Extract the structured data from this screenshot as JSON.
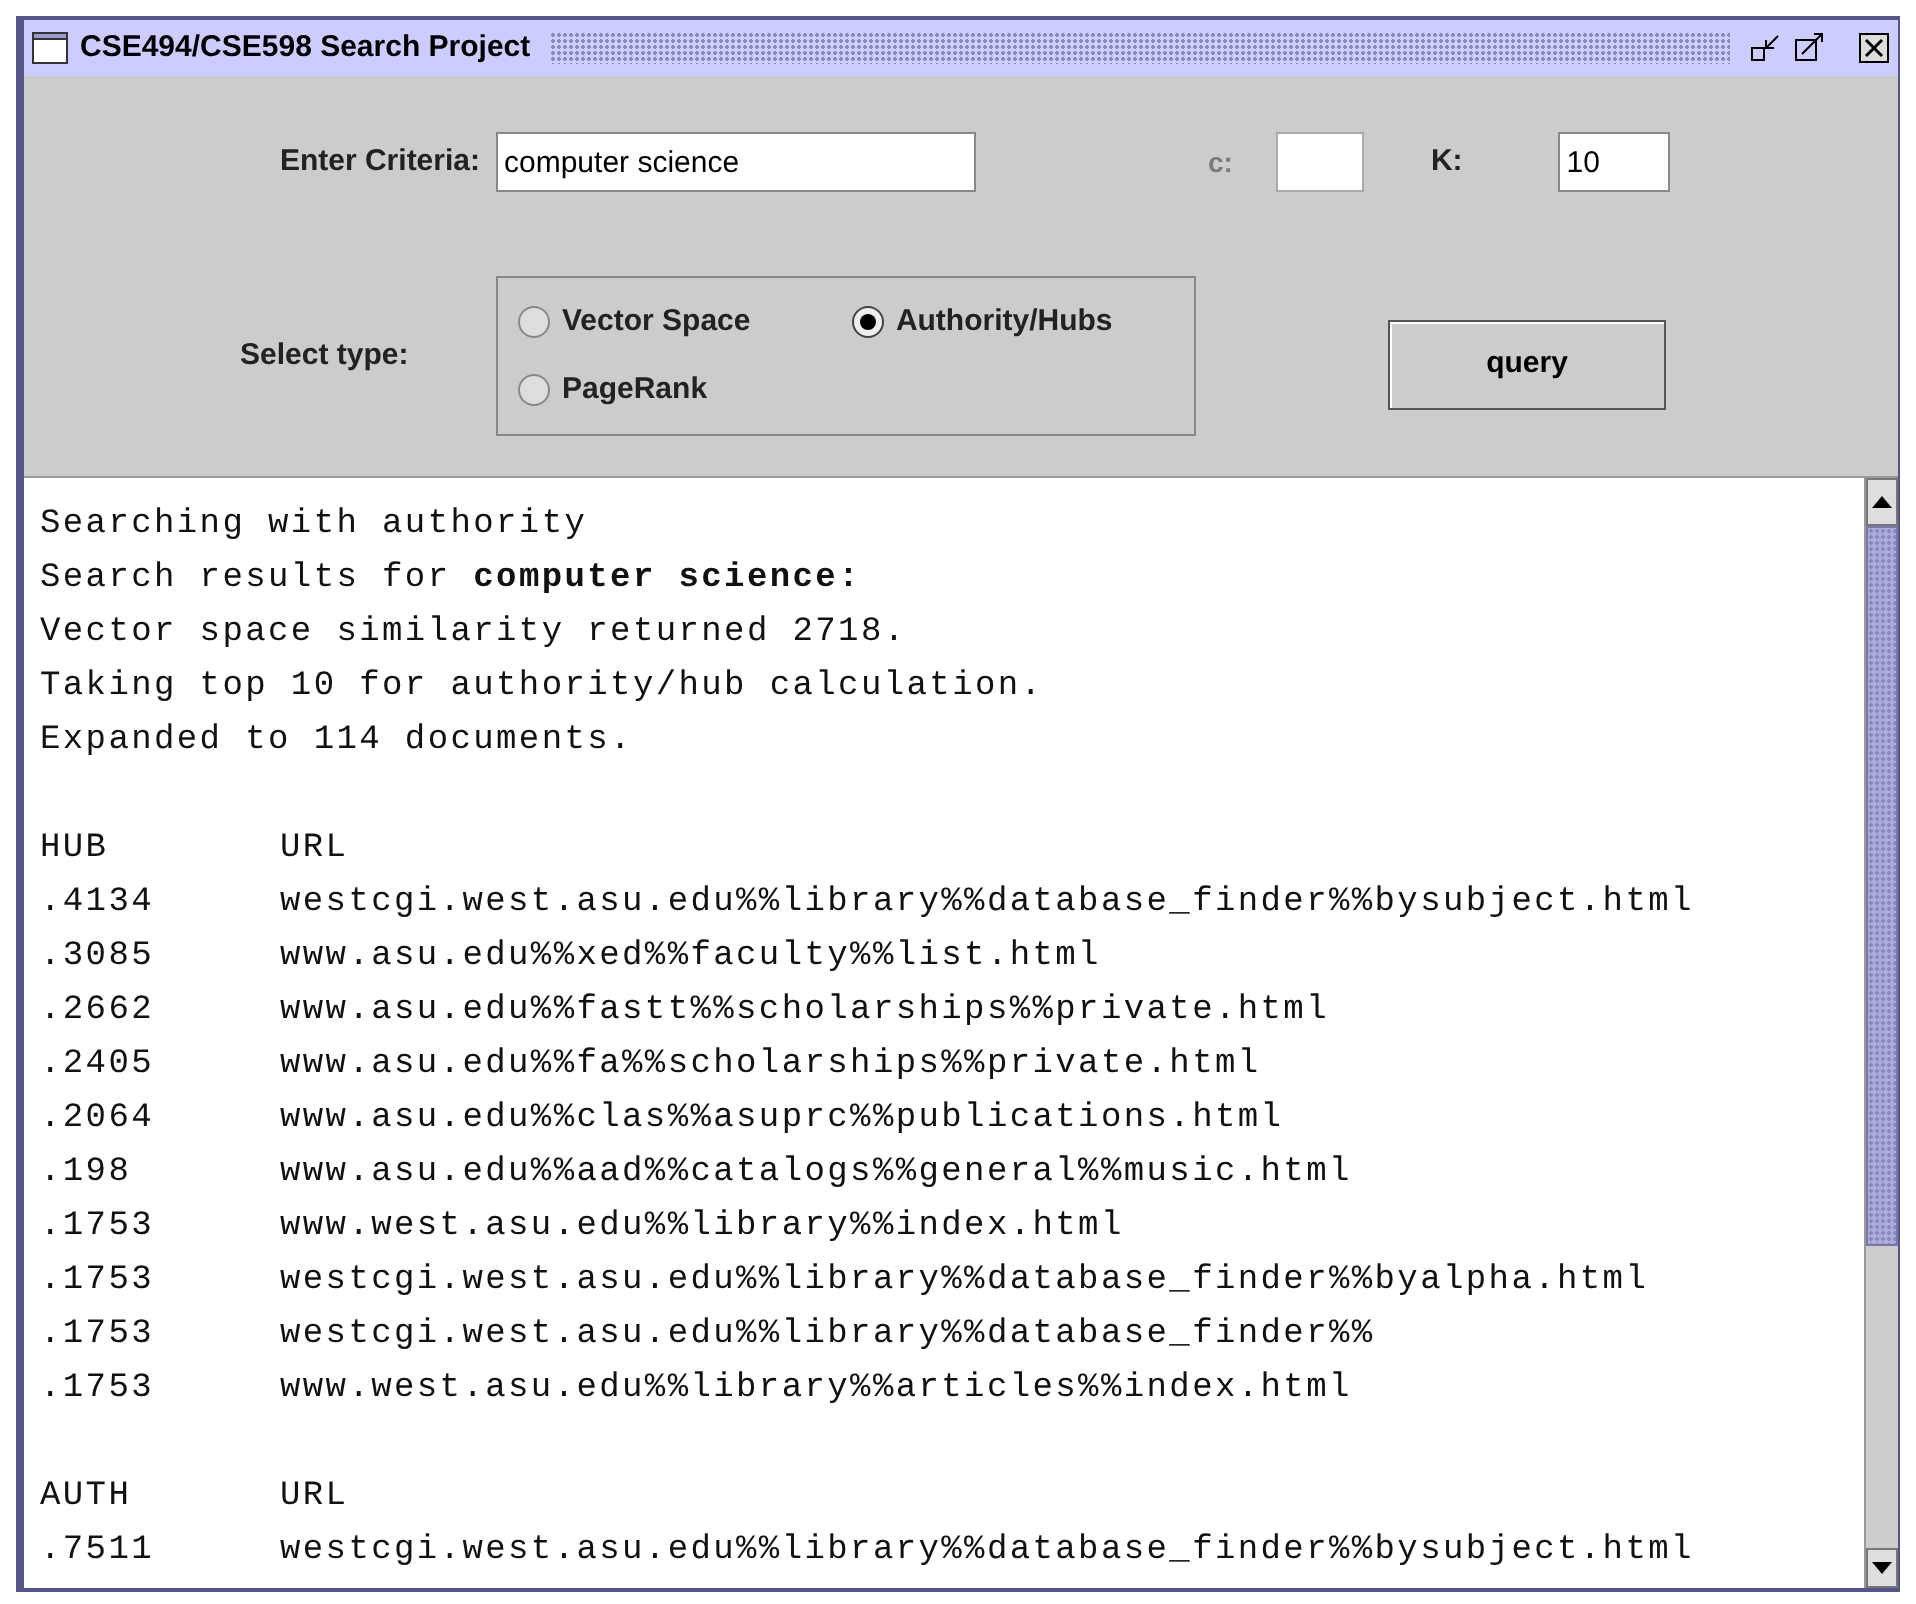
{
  "window": {
    "title": "CSE494/CSE598 Search Project"
  },
  "form": {
    "criteria_label": "Enter Criteria:",
    "criteria_value": "computer science",
    "c_label": "c:",
    "k_label": "K:",
    "k_value": "10",
    "type_label": "Select type:",
    "types": [
      {
        "label": "Vector Space",
        "selected": false
      },
      {
        "label": "Authority/Hubs",
        "selected": true
      },
      {
        "label": "PageRank",
        "selected": false
      }
    ],
    "query_button": "query"
  },
  "output": {
    "lines": [
      {
        "kind": "text",
        "text": "Searching with authority"
      },
      {
        "kind": "text",
        "text": "Search results for **computer science:**"
      },
      {
        "kind": "text",
        "text": "Vector space similarity returned 2718."
      },
      {
        "kind": "text",
        "text": "Taking top 10 for authority/hub calculation."
      },
      {
        "kind": "text",
        "text": "Expanded to 114 documents."
      },
      {
        "kind": "blank"
      },
      {
        "kind": "row",
        "score": "HUB",
        "url": "URL"
      },
      {
        "kind": "row",
        "score": ".4134",
        "url": "westcgi.west.asu.edu%%library%%database_finder%%bysubject.html"
      },
      {
        "kind": "row",
        "score": ".3085",
        "url": "www.asu.edu%%xed%%faculty%%list.html"
      },
      {
        "kind": "row",
        "score": ".2662",
        "url": "www.asu.edu%%fastt%%scholarships%%private.html"
      },
      {
        "kind": "row",
        "score": ".2405",
        "url": "www.asu.edu%%fa%%scholarships%%private.html"
      },
      {
        "kind": "row",
        "score": ".2064",
        "url": "www.asu.edu%%clas%%asuprc%%publications.html"
      },
      {
        "kind": "row",
        "score": ".198",
        "url": "www.asu.edu%%aad%%catalogs%%general%%music.html"
      },
      {
        "kind": "row",
        "score": ".1753",
        "url": "www.west.asu.edu%%library%%index.html"
      },
      {
        "kind": "row",
        "score": ".1753",
        "url": "westcgi.west.asu.edu%%library%%database_finder%%byalpha.html"
      },
      {
        "kind": "row",
        "score": ".1753",
        "url": "westcgi.west.asu.edu%%library%%database_finder%%"
      },
      {
        "kind": "row",
        "score": ".1753",
        "url": "www.west.asu.edu%%library%%articles%%index.html"
      },
      {
        "kind": "blank"
      },
      {
        "kind": "row",
        "score": "AUTH",
        "url": "URL"
      },
      {
        "kind": "row",
        "score": ".7511",
        "url": "westcgi.west.asu.edu%%library%%database_finder%%bysubject.html"
      }
    ]
  }
}
